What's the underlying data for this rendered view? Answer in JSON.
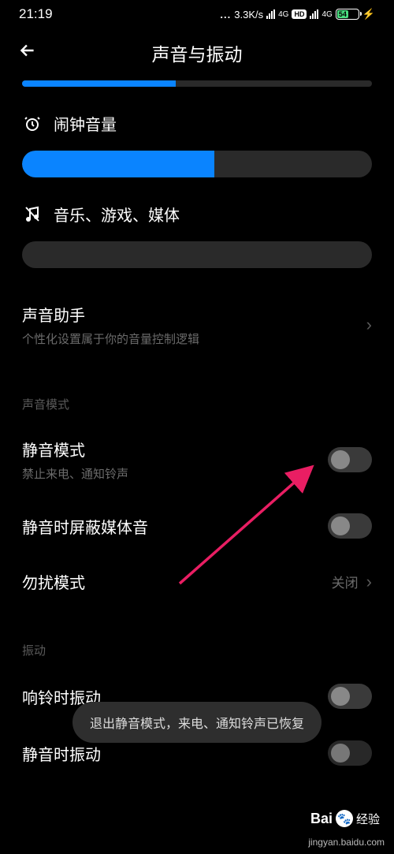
{
  "status": {
    "time": "21:19",
    "speed": "3.3K/s",
    "net1": "4G",
    "net2": "4G",
    "hd": "HD",
    "battery_pct": "54",
    "battery_width": "54%"
  },
  "header": {
    "title": "声音与振动"
  },
  "sliders": {
    "partial_fill": "44%",
    "alarm": {
      "label": "闹钟音量",
      "fill": "55%"
    },
    "media": {
      "label": "音乐、游戏、媒体",
      "fill": "0%"
    }
  },
  "assistant": {
    "title": "声音助手",
    "subtitle": "个性化设置属于你的音量控制逻辑"
  },
  "groups": {
    "sound_mode": "声音模式",
    "vibration": "振动"
  },
  "items": {
    "silent": {
      "title": "静音模式",
      "subtitle": "禁止来电、通知铃声"
    },
    "mute_media": {
      "title": "静音时屏蔽媒体音"
    },
    "dnd": {
      "title": "勿扰模式",
      "value": "关闭"
    },
    "vibrate_ring": {
      "title": "响铃时振动"
    },
    "vibrate_silent": {
      "title": "静音时振动"
    }
  },
  "toast": {
    "text": "退出静音模式，来电、通知铃声已恢复"
  },
  "watermark": {
    "brand": "Bai",
    "brand2": "经验",
    "url": "jingyan.baidu.com"
  }
}
